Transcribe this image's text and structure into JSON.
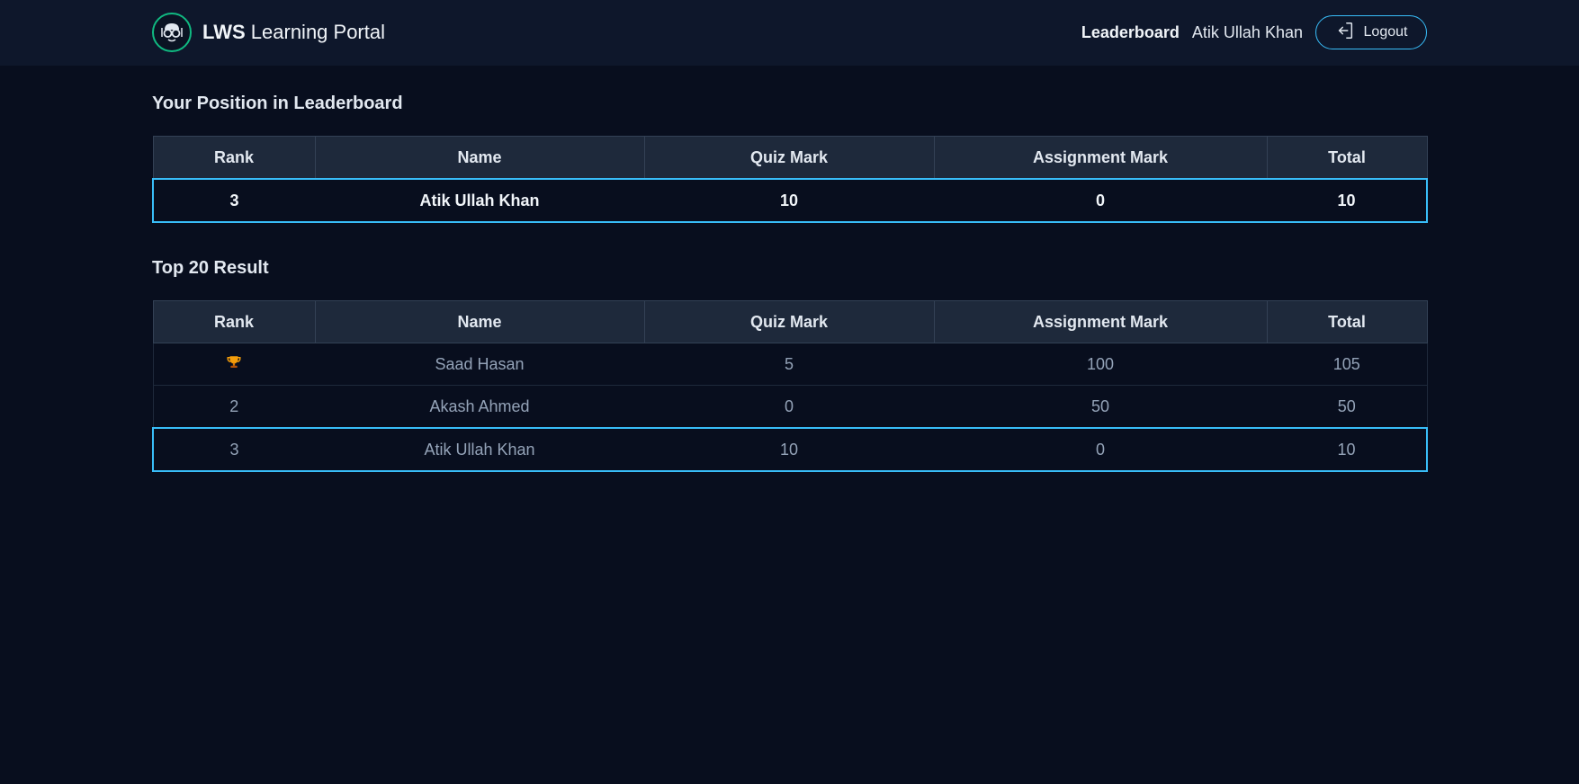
{
  "header": {
    "brand_bold": "LWS",
    "brand_rest": " Learning Portal",
    "nav_link": "Leaderboard",
    "user_name": "Atik Ullah Khan",
    "logout_label": "Logout"
  },
  "position_section": {
    "title": "Your Position in Leaderboard",
    "columns": [
      "Rank",
      "Name",
      "Quiz Mark",
      "Assignment Mark",
      "Total"
    ],
    "row": {
      "rank": "3",
      "name": "Atik Ullah Khan",
      "quiz": "10",
      "assignment": "0",
      "total": "10"
    }
  },
  "top_section": {
    "title": "Top 20 Result",
    "columns": [
      "Rank",
      "Name",
      "Quiz Mark",
      "Assignment Mark",
      "Total"
    ],
    "rows": [
      {
        "rank_icon": "trophy-icon",
        "name": "Saad Hasan",
        "quiz": "5",
        "assignment": "100",
        "total": "105"
      },
      {
        "rank": "2",
        "name": "Akash Ahmed",
        "quiz": "0",
        "assignment": "50",
        "total": "50"
      },
      {
        "rank": "3",
        "name": "Atik Ullah Khan",
        "quiz": "10",
        "assignment": "0",
        "total": "10"
      }
    ]
  },
  "colors": {
    "background": "#080e1e",
    "navbar": "#0e172b",
    "header_row": "#1e293b",
    "highlight_border": "#38bdf8",
    "logo_ring": "#10b981",
    "trophy": "#f59e0b"
  }
}
